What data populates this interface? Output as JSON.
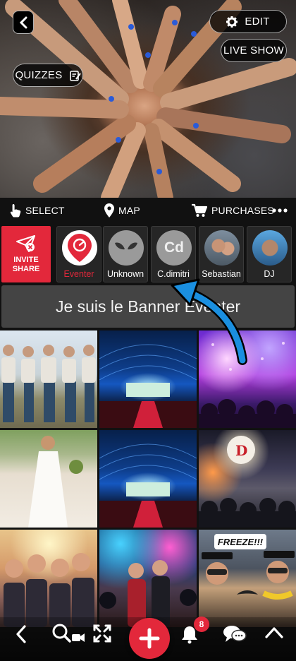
{
  "hero": {
    "edit_label": "EDIT",
    "live_show_label": "LIVE SHOW",
    "quizzes_label": "QUIZZES"
  },
  "action_bar": {
    "select_label": "SELECT",
    "map_label": "MAP",
    "purchases_label": "PURCHASES"
  },
  "invite": {
    "line1": "INVITE",
    "line2": "SHARE"
  },
  "contributors": [
    {
      "name": "Eventer",
      "color": "#e3283b",
      "initials": ""
    },
    {
      "name": "Unknown",
      "color": "#ffffff",
      "initials": ""
    },
    {
      "name": "C.dimitri",
      "color": "#ffffff",
      "initials": "Cd"
    },
    {
      "name": "Sebastian",
      "color": "#ffffff",
      "initials": ""
    },
    {
      "name": "DJ",
      "color": "#ffffff",
      "initials": ""
    }
  ],
  "banner": {
    "text": "Je suis le Banner Eventer"
  },
  "photos": {
    "freeze_text": "FREEZE!!!"
  },
  "nav": {
    "notification_count": "8"
  },
  "colors": {
    "accent": "#e3283b",
    "arrow": "#1a8fe0"
  }
}
